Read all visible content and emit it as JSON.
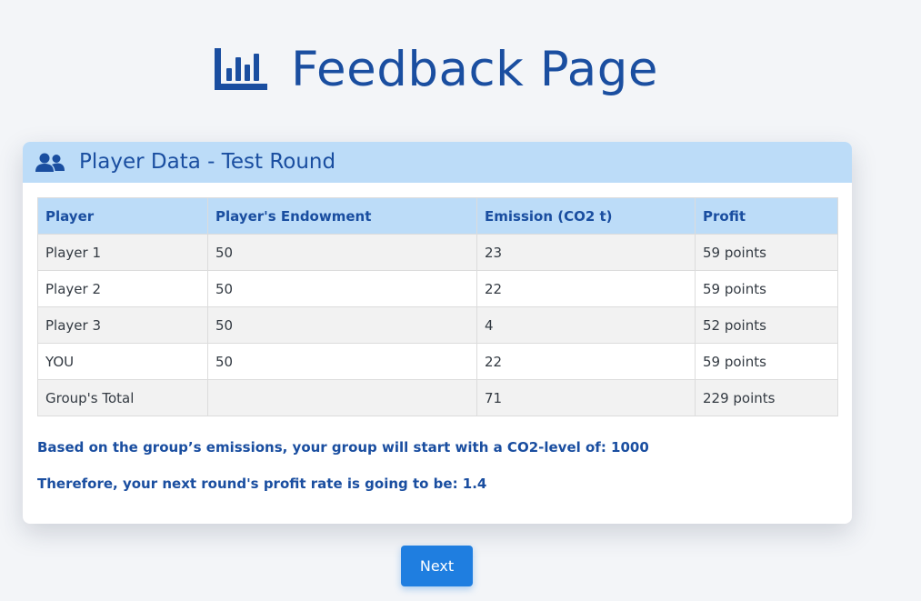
{
  "header": {
    "title": "Feedback Page",
    "icon": "chart-bar-icon"
  },
  "card": {
    "title": "Player Data - Test Round",
    "icon": "users-icon",
    "table": {
      "columns": [
        "Player",
        "Player's Endowment",
        "Emission (CO2 t)",
        "Profit"
      ],
      "rows": [
        [
          "Player 1",
          "50",
          "23",
          "59 points"
        ],
        [
          "Player 2",
          "50",
          "22",
          "59 points"
        ],
        [
          "Player 3",
          "50",
          "4",
          "52 points"
        ],
        [
          "YOU",
          "50",
          "22",
          "59 points"
        ],
        [
          "Group's Total",
          "",
          "71",
          "229 points"
        ]
      ]
    },
    "co2_message": "Based on the group’s emissions, your group will start with a CO2-level of: 1000",
    "rate_message": "Therefore, your next round's profit rate is going to be: 1.4"
  },
  "next_button": {
    "label": "Next"
  },
  "colors": {
    "primary": "#1a4ea0",
    "header_bg": "#bcdcf8",
    "button": "#1f7ee0",
    "page_bg": "#f3f5f8"
  }
}
